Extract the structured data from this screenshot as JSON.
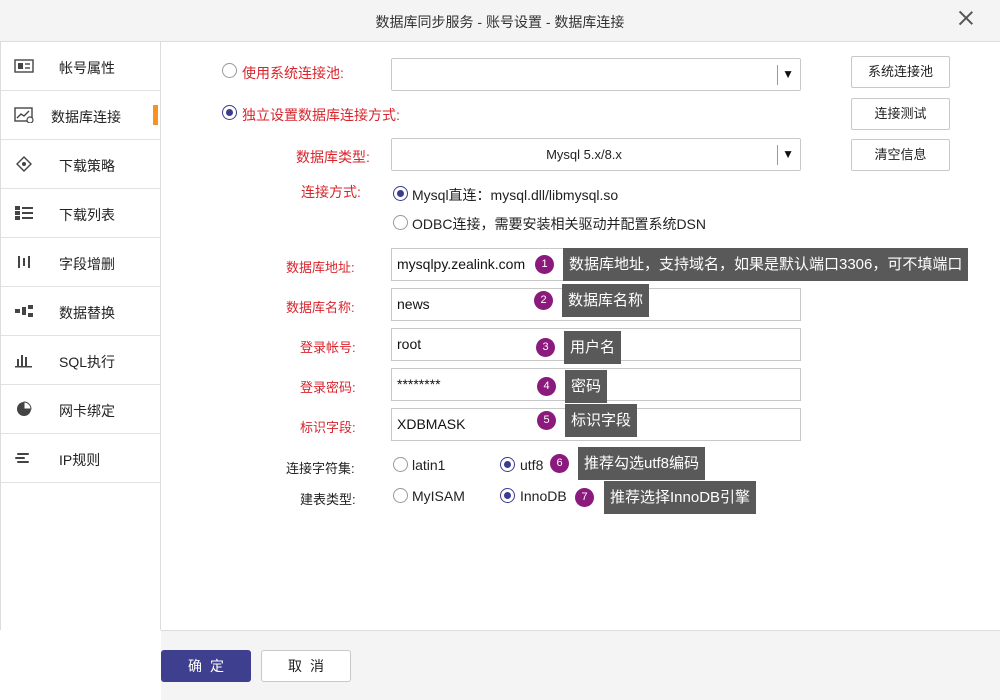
{
  "window": {
    "title": "数据库同步服务 - 账号设置 - 数据库连接"
  },
  "sidebar": {
    "items": [
      {
        "label": "帐号属性",
        "icon": "profile-card-icon"
      },
      {
        "label": "数据库连接",
        "icon": "database-chart-icon",
        "active": true
      },
      {
        "label": "下载策略",
        "icon": "diamond-node-icon"
      },
      {
        "label": "下载列表",
        "icon": "list-icon"
      },
      {
        "label": "字段增删",
        "icon": "field-bars-icon"
      },
      {
        "label": "数据替换",
        "icon": "replace-blocks-icon"
      },
      {
        "label": "SQL执行",
        "icon": "bar-chart-icon"
      },
      {
        "label": "网卡绑定",
        "icon": "pie-chart-icon"
      },
      {
        "label": "IP规则",
        "icon": "rule-lines-icon"
      }
    ],
    "accent_color": "#f7931e"
  },
  "form": {
    "system_pool": {
      "label": "使用系统连接池:",
      "value": ""
    },
    "custom_conn": {
      "label": "独立设置数据库连接方式:"
    },
    "db_type": {
      "label": "数据库类型:",
      "value": "Mysql 5.x/8.x"
    },
    "conn_method": {
      "label": "连接方式:",
      "options": [
        "Mysql直连：mysql.dll/libmysql.so",
        "ODBC连接，需要安装相关驱动并配置系统DSN"
      ]
    },
    "db_address": {
      "label": "数据库地址:",
      "value": "mysqlpy.zealink.com"
    },
    "db_name": {
      "label": "数据库名称:",
      "value": "news"
    },
    "login_account": {
      "label": "登录帐号:",
      "value": "root"
    },
    "login_password": {
      "label": "登录密码:",
      "value": "********"
    },
    "mark_field": {
      "label": "标识字段:",
      "value": "XDBMASK"
    },
    "charset": {
      "label": "连接字符集:",
      "options": [
        "latin1",
        "utf8"
      ]
    },
    "table_type": {
      "label": "建表类型:",
      "options": [
        "MyISAM",
        "InnoDB"
      ]
    }
  },
  "buttons": {
    "system_pool": "系统连接池",
    "test_conn": "连接测试",
    "clear_info": "清空信息",
    "ok": "确定",
    "cancel": "取消"
  },
  "annotations": [
    {
      "num": "1",
      "text": "数据库地址，支持域名，如果是默认端口3306，可不填端口"
    },
    {
      "num": "2",
      "text": "数据库名称"
    },
    {
      "num": "3",
      "text": "用户名"
    },
    {
      "num": "4",
      "text": "密码"
    },
    {
      "num": "5",
      "text": "标识字段"
    },
    {
      "num": "6",
      "text": "推荐勾选utf8编码"
    },
    {
      "num": "7",
      "text": "推荐选择InnoDB引擎"
    }
  ],
  "colors": {
    "primary": "#3f3f8f",
    "label_red": "#d9242c",
    "badge": "#8a1a7c",
    "tooltip": "#595959"
  }
}
